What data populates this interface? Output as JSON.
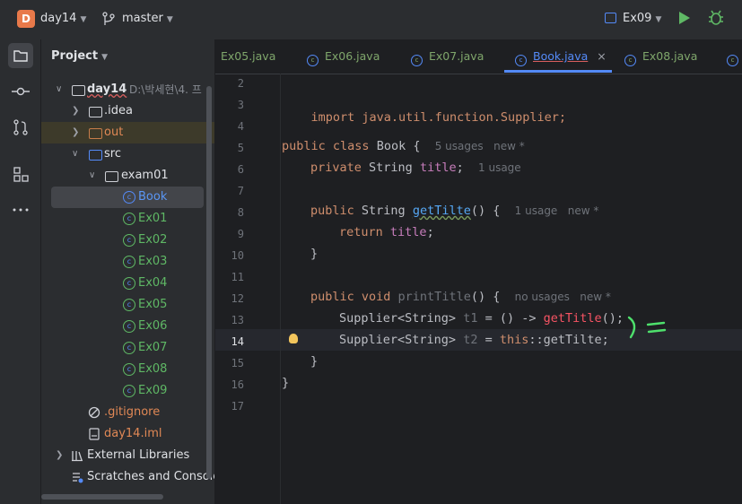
{
  "toolbar": {
    "project_letter": "D",
    "project_name": "day14",
    "branch": "master",
    "run_config": "Ex09"
  },
  "project_panel": {
    "title": "Project",
    "tree": [
      {
        "label": "day14",
        "path": "D:\\박세현\\4. 프",
        "arrow": "expanded",
        "icon": "module-folder"
      },
      {
        "label": ".idea",
        "arrow": "collapsed",
        "icon": "folder"
      },
      {
        "label": "out",
        "arrow": "collapsed",
        "icon": "folder-excluded"
      },
      {
        "label": "src",
        "arrow": "expanded",
        "icon": "source-folder"
      },
      {
        "label": "exam01",
        "arrow": "expanded",
        "icon": "package"
      },
      {
        "label": "Book",
        "icon": "class"
      },
      {
        "label": "Ex01",
        "icon": "runnable-class"
      },
      {
        "label": "Ex02",
        "icon": "runnable-class"
      },
      {
        "label": "Ex03",
        "icon": "runnable-class"
      },
      {
        "label": "Ex04",
        "icon": "runnable-class"
      },
      {
        "label": "Ex05",
        "icon": "runnable-class"
      },
      {
        "label": "Ex06",
        "icon": "runnable-class"
      },
      {
        "label": "Ex07",
        "icon": "runnable-class"
      },
      {
        "label": "Ex08",
        "icon": "runnable-class"
      },
      {
        "label": "Ex09",
        "icon": "runnable-class"
      },
      {
        "label": ".gitignore",
        "icon": "ignore-file"
      },
      {
        "label": "day14.iml",
        "icon": "iml-file"
      },
      {
        "label": "External Libraries",
        "arrow": "collapsed",
        "icon": "library"
      },
      {
        "label": "Scratches and Consoles",
        "icon": "scratches"
      }
    ]
  },
  "tabs": [
    {
      "label": "Ex05.java"
    },
    {
      "label": "Ex06.java"
    },
    {
      "label": "Ex07.java"
    },
    {
      "label": "Book.java",
      "active": true,
      "close": "×"
    },
    {
      "label": "Ex08.java"
    }
  ],
  "code": {
    "line_numbers": [
      "2",
      "3",
      "4",
      "5",
      "6",
      "7",
      "8",
      "9",
      "10",
      "11",
      "12",
      "13",
      "14",
      "15",
      "16",
      "17"
    ],
    "l3": "import java.util.function.Supplier;",
    "l5_kw": "public class",
    "l5_name": "Book {",
    "l5_hint": "5 usages   new *",
    "l6_kw": "private",
    "l6_type": "String",
    "l6_field": "title",
    "l6_semi": ";",
    "l6_hint": "1 usage",
    "l8_kw": "public",
    "l8_type": "String",
    "l8_method": "getTilte",
    "l8_rest": "() {",
    "l8_hint": "1 usage   new *",
    "l9_kw": "return",
    "l9_field": "title",
    "l9_semi": ";",
    "l10": "}",
    "l12_kw": "public void",
    "l12_method": "printTitle",
    "l12_rest": "() {",
    "l12_hint": "no usages   new *",
    "l13_type": "Supplier<String>",
    "l13_var": "t1",
    "l13_mid": "= () ->",
    "l13_call": "getTitle",
    "l13_end": "();",
    "l14_type": "Supplier<String>",
    "l14_var": "t2",
    "l14_eq": "=",
    "l14_kw": "this",
    "l14_end": "::getTilte;",
    "l15": "}",
    "l16": "}"
  },
  "annotation": {
    "color": "#4ee06c"
  }
}
